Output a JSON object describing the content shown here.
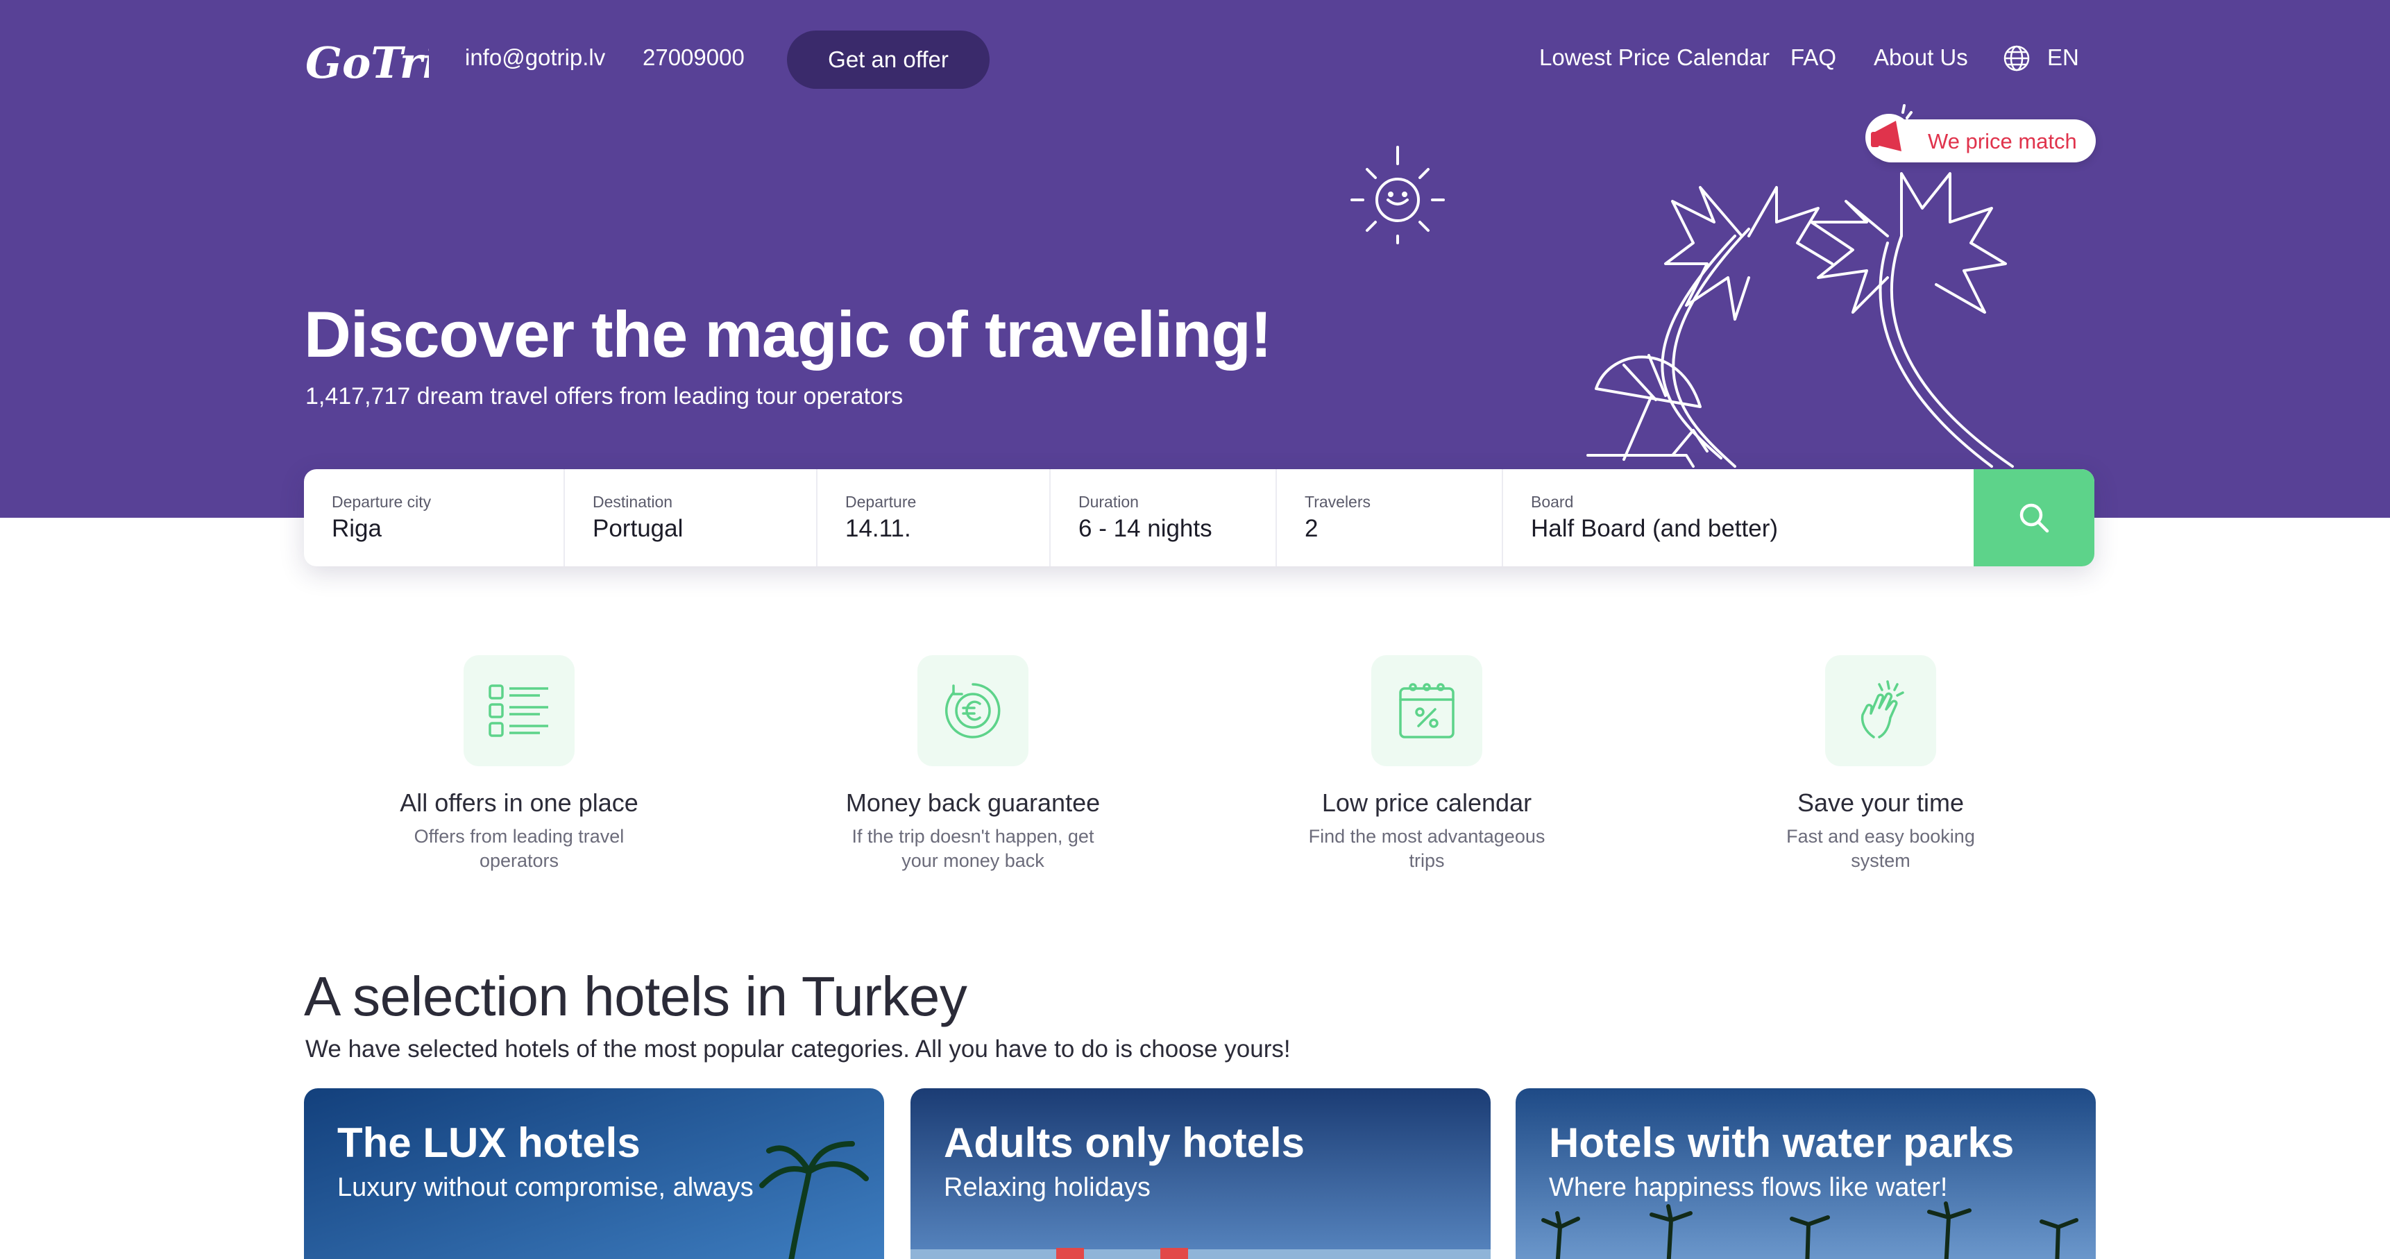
{
  "header": {
    "email": "info@gotrip.lv",
    "phone": "27009000",
    "offer_button": "Get an offer",
    "nav": [
      "Lowest Price Calendar",
      "FAQ",
      "About Us"
    ],
    "language": "EN",
    "logo_icon": "gotrip-logo"
  },
  "badge": {
    "label": "We price match",
    "icon": "megaphone-icon"
  },
  "hero": {
    "title": "Discover the magic of traveling!",
    "subtitle": "1,417,717 dream travel offers from leading tour operators"
  },
  "search": {
    "fields": [
      {
        "label": "Departure city",
        "value": "Riga"
      },
      {
        "label": "Destination",
        "value": "Portugal"
      },
      {
        "label": "Departure",
        "value": "14.11."
      },
      {
        "label": "Duration",
        "value": "6 - 14 nights"
      },
      {
        "label": "Travelers",
        "value": "2"
      },
      {
        "label": "Board",
        "value": "Half Board (and better)"
      }
    ],
    "button_icon": "search-icon"
  },
  "features": [
    {
      "title": "All offers in one place",
      "desc": "Offers from leading travel operators",
      "icon": "list-icon"
    },
    {
      "title": "Money back guarantee",
      "desc": "If the trip doesn't happen, get your money back",
      "icon": "euro-refund-icon"
    },
    {
      "title": "Low price calendar",
      "desc": "Find the most advantageous trips",
      "icon": "calendar-percent-icon"
    },
    {
      "title": "Save your time",
      "desc": "Fast and easy booking system",
      "icon": "hand-tap-icon"
    }
  ],
  "section": {
    "title": "A selection hotels in Turkey",
    "subtitle": "We have selected hotels of the most popular categories. All you have to do is choose yours!"
  },
  "cards": [
    {
      "title": "The LUX hotels",
      "subtitle": "Luxury without compromise, always"
    },
    {
      "title": "Adults only hotels",
      "subtitle": "Relaxing holidays"
    },
    {
      "title": "Hotels with water parks",
      "subtitle": "Where happiness flows like water!"
    }
  ],
  "colors": {
    "hero_bg": "#584196",
    "accent_green": "#5dd38a",
    "price_match_red": "#e0334c",
    "offer_button_bg": "#3a2a6b"
  }
}
